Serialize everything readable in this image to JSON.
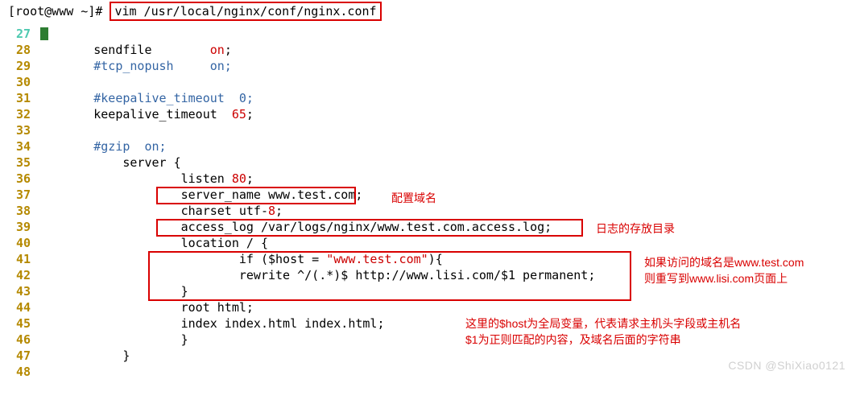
{
  "shell": {
    "prompt": "[root@www ~]# ",
    "command": "vim /usr/local/nginx/conf/nginx.conf"
  },
  "lines": {
    "l27": "27",
    "l28": "28",
    "l29": "29",
    "l30": "30",
    "l31": "31",
    "l32": "32",
    "l33": "33",
    "l34": "34",
    "l35": "35",
    "l36": "36",
    "l37": "37",
    "l38": "38",
    "l39": "39",
    "l40": "40",
    "l41": "41",
    "l42": "42",
    "l43": "43",
    "l44": "44",
    "l45": "45",
    "l46": "46",
    "l47": "47",
    "l48": "48"
  },
  "code": {
    "c28_a": "        sendfile        ",
    "c28_b": "on",
    "c28_c": ";",
    "c29": "        #tcp_nopush     on;",
    "c31": "        #keepalive_timeout  0;",
    "c32_a": "        keepalive_timeout  ",
    "c32_b": "65",
    "c32_c": ";",
    "c34": "        #gzip  on;",
    "c35": "            server {",
    "c36_a": "                    listen ",
    "c36_b": "80",
    "c36_c": ";",
    "c37": "                    server_name www.test.com;",
    "c38_a": "                    charset utf-",
    "c38_b": "8",
    "c38_c": ";",
    "c39": "                    access_log /var/logs/nginx/www.test.com.access.log;",
    "c40": "                    location / {",
    "c41_a": "                            if ($host = ",
    "c41_b": "\"www.test.com\"",
    "c41_c": "){",
    "c42": "                            rewrite ^/(.*)$ http://www.lisi.com/$1 permanent;",
    "c43": "                    }",
    "c44": "                    root html;",
    "c45": "                    index index.html index.html;",
    "c46": "                    }",
    "c47": "            }"
  },
  "annotations": {
    "a_domain": "配置域名",
    "a_logdir": "日志的存放目录",
    "a_if1": "如果访问的域名是www.test.com",
    "a_if2": "则重写到www.lisi.com页面上",
    "a_host1": "这里的$host为全局变量，代表请求主机头字段或主机名",
    "a_host2": "$1为正则匹配的内容，及域名后面的字符串"
  },
  "watermark": "CSDN @ShiXiao0121"
}
